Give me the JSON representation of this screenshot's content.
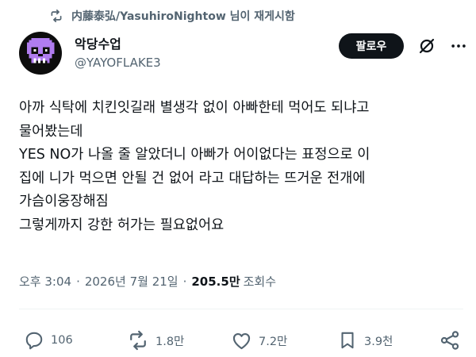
{
  "repost": {
    "text": "内藤泰弘/YasuhiroNightow 님이 재게시함",
    "icon": "repost-icon"
  },
  "author": {
    "display_name": "악당수업",
    "handle": "@YAYOFLAKE3",
    "avatar_icon": "skull-avatar"
  },
  "header": {
    "follow_label": "팔로우",
    "grok_icon": "grok-icon",
    "more_icon": "more-icon"
  },
  "tweet": {
    "lines": [
      "아까 식탁에 치킨잇길래 별생각 없이 아빠한테 먹어도 되냐고",
      "물어봤는데",
      "YES NO가 나올 줄 알았더니 아빠가 어이없다는 표정으로 이",
      "집에 니가 먹으면 안될 건 없어 라고 대답하는 뜨거운 전개에",
      "가슴이웅장해짐",
      "그렇게까지 강한 허가는 필요없어요"
    ]
  },
  "meta": {
    "time": "오후 3:04",
    "separator": "·",
    "date": "2026년 7월 21일",
    "views_count": "205.5만",
    "views_label": "조회수"
  },
  "actions": {
    "reply_count": "106",
    "repost_count": "1.8만",
    "like_count": "7.2만",
    "bookmark_count": "3.9천"
  },
  "colors": {
    "text_primary": "#0f1419",
    "text_secondary": "#536471",
    "follow_bg": "#0f1419",
    "avatar_skull": "#b07cf0"
  }
}
